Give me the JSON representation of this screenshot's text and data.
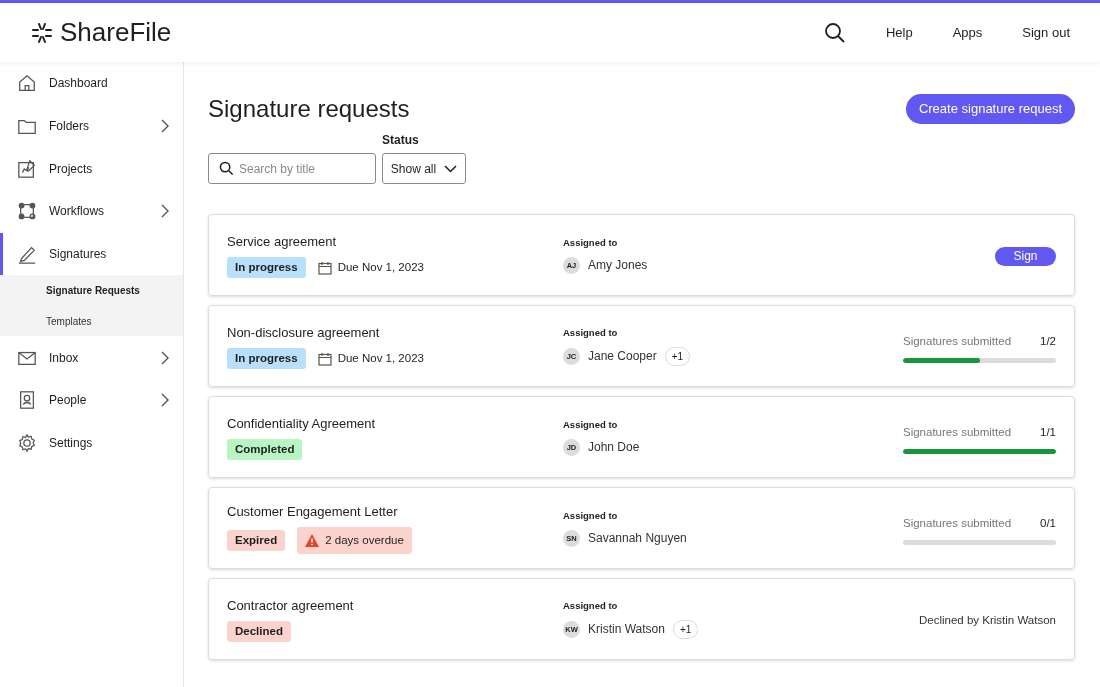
{
  "header": {
    "logo": "ShareFile",
    "links": [
      "Help",
      "Apps",
      "Sign out"
    ]
  },
  "sidebar": {
    "items": [
      {
        "label": "Dashboard",
        "kind": "home",
        "expandable": false,
        "selected": false
      },
      {
        "label": "Folders",
        "kind": "folder",
        "expandable": true,
        "selected": false
      },
      {
        "label": "Projects",
        "kind": "projects",
        "expandable": false,
        "selected": false
      },
      {
        "label": "Workflows",
        "kind": "workflows",
        "expandable": true,
        "selected": false
      },
      {
        "label": "Signatures",
        "kind": "signatures",
        "expandable": false,
        "selected": true,
        "children": [
          {
            "label": "Signature Requests",
            "selected": true
          },
          {
            "label": "Templates",
            "selected": false
          }
        ]
      },
      {
        "label": "Inbox",
        "kind": "inbox",
        "expandable": true,
        "selected": false
      },
      {
        "label": "People",
        "kind": "people",
        "expandable": true,
        "selected": false
      },
      {
        "label": "Settings",
        "kind": "settings",
        "expandable": false,
        "selected": false
      }
    ]
  },
  "page": {
    "title": "Signature requests",
    "create_button": "Create signature request",
    "search": {
      "placeholder": "Search by title"
    },
    "status_filter": {
      "label": "Status",
      "value": "Show all"
    }
  },
  "requests": [
    {
      "title": "Service agreement",
      "badges": [
        {
          "label": "In progress",
          "kind": "progress"
        },
        {
          "label": "Due Nov 1, 2023",
          "kind": "due"
        }
      ],
      "assigned_label": "Assigned to",
      "initials": "AJ",
      "assignee": "Amy Jones",
      "right": {
        "kind": "button",
        "label": "Sign"
      }
    },
    {
      "title": "Non-disclosure agreement",
      "badges": [
        {
          "label": "In progress",
          "kind": "progress"
        },
        {
          "label": "Due Nov 1, 2023",
          "kind": "due"
        }
      ],
      "assigned_label": "Assigned to",
      "initials": "JC",
      "assignee": "Jane Cooper",
      "extra": "+1",
      "right": {
        "kind": "meter",
        "label": "Signatures submitted",
        "count": "1/2",
        "level": 0.5
      }
    },
    {
      "title": "Confidentiality Agreement",
      "badges": [
        {
          "label": "Completed",
          "kind": "completed"
        }
      ],
      "assigned_label": "Assigned to",
      "initials": "JD",
      "assignee": "John Doe",
      "right": {
        "kind": "meter",
        "label": "Signatures submitted",
        "count": "1/1",
        "level": 1
      }
    },
    {
      "title": "Customer Engagement Letter",
      "badges": [
        {
          "label": "Expired",
          "kind": "expired"
        },
        {
          "label": "2 days overdue",
          "kind": "overdue"
        }
      ],
      "assigned_label": "Assigned to",
      "initials": "SN",
      "assignee": "Savannah Nguyen",
      "right": {
        "kind": "meter",
        "label": "Signatures submitted",
        "count": "0/1",
        "level": 0
      }
    },
    {
      "title": "Contractor agreement",
      "badges": [
        {
          "label": "Declined",
          "kind": "declined"
        }
      ],
      "assigned_label": "Assigned to",
      "initials": "KW",
      "assignee": "Kristin Watson",
      "extra": "+1",
      "right": {
        "kind": "text",
        "label": "Declined by Kristin Watson"
      }
    }
  ]
}
